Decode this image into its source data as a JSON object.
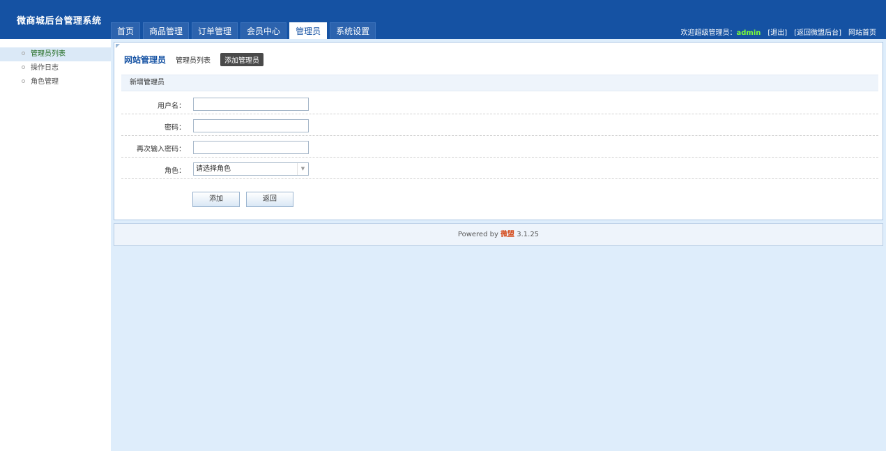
{
  "app": {
    "title": "微商城后台管理系统"
  },
  "topnav": [
    {
      "label": "首页"
    },
    {
      "label": "商品管理"
    },
    {
      "label": "订单管理"
    },
    {
      "label": "会员中心"
    },
    {
      "label": "管理员",
      "active": true
    },
    {
      "label": "系统设置"
    }
  ],
  "userbar": {
    "welcome": "欢迎超级管理员：",
    "username": "admin",
    "logout": "[退出]",
    "back": "[返回微盟后台]",
    "home": "网站首页"
  },
  "sidebar": {
    "items": [
      {
        "label": "管理员列表",
        "active": true
      },
      {
        "label": "操作日志"
      },
      {
        "label": "角色管理"
      }
    ]
  },
  "panel": {
    "title": "网站管理员",
    "tabs": [
      {
        "label": "管理员列表"
      },
      {
        "label": "添加管理员",
        "active": true
      }
    ],
    "section": "新增管理员"
  },
  "form": {
    "username_label": "用户名：",
    "username_value": "",
    "password_label": "密码：",
    "password_value": "",
    "confirm_label": "再次输入密码：",
    "confirm_value": "",
    "role_label": "角色：",
    "role_selected": "请选择角色",
    "add_button": "添加",
    "back_button": "返回"
  },
  "footer": {
    "prefix": "Powered by ",
    "brand": "微盟",
    "version": " 3.1.25"
  },
  "colors": {
    "header": "#1552a3",
    "main_bg": "#deedfb",
    "admin_name": "#7cfc3a"
  }
}
